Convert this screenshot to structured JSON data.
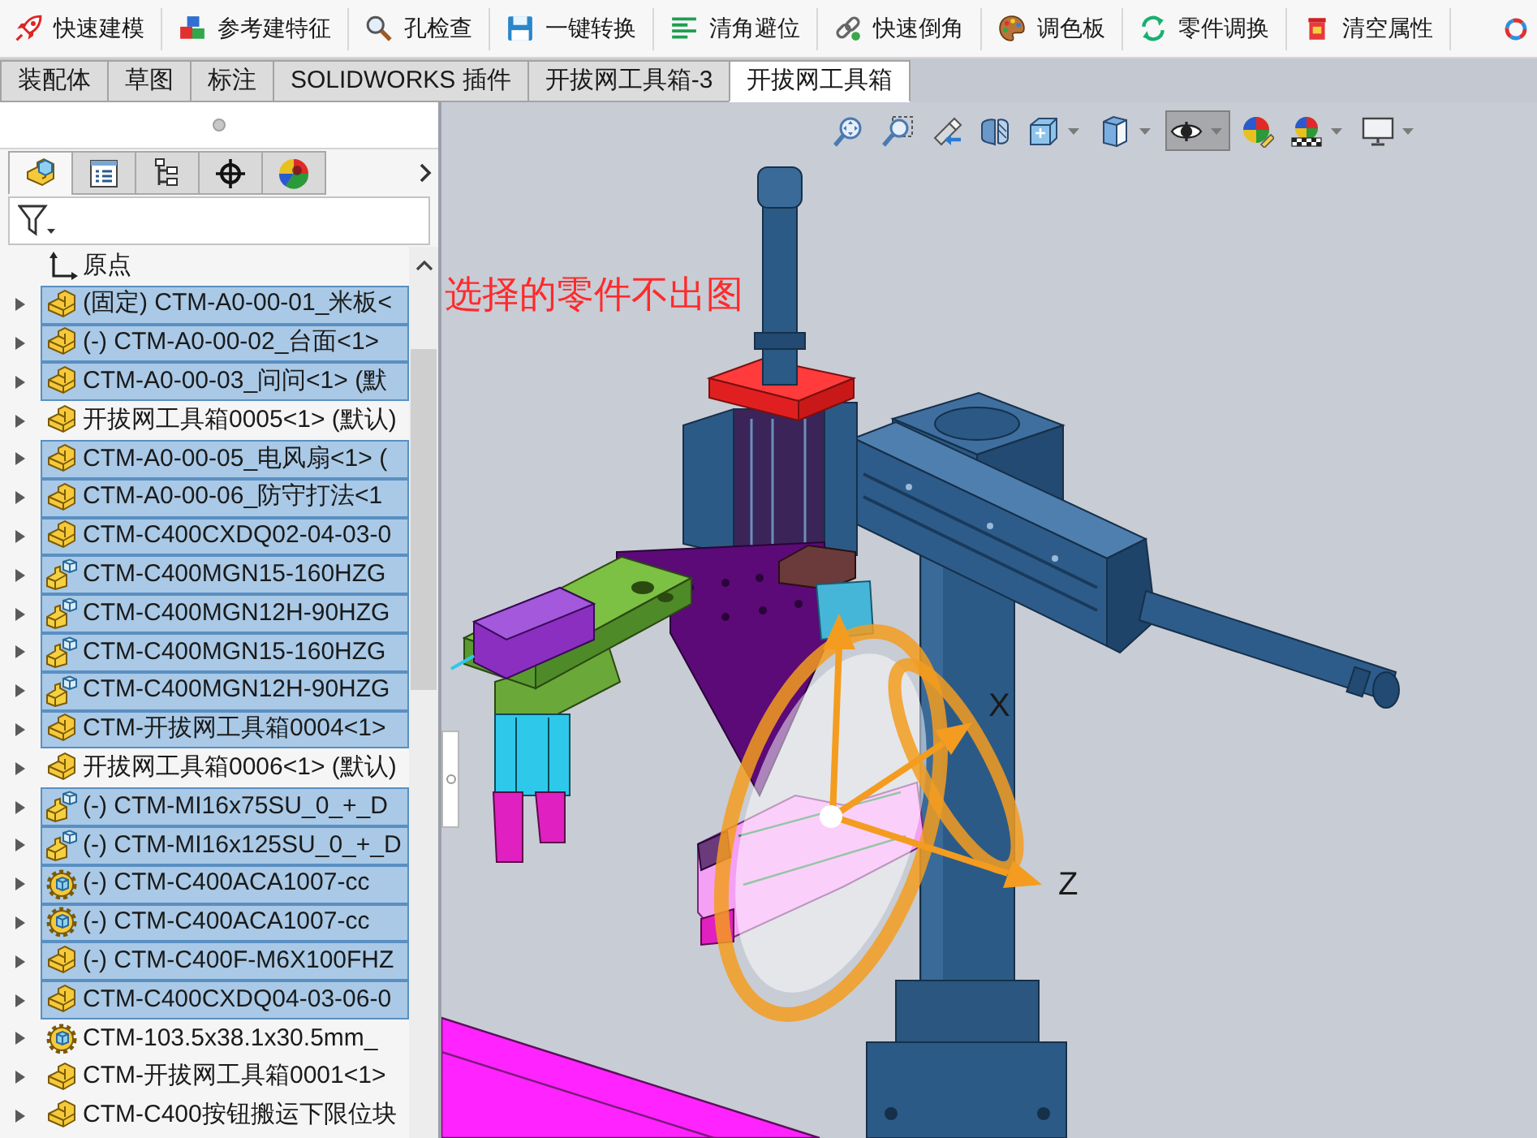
{
  "toolbar": {
    "buttons": [
      {
        "label": "快速建模"
      },
      {
        "label": "参考建特征"
      },
      {
        "label": "孔检查"
      },
      {
        "label": "一键转换"
      },
      {
        "label": "清角避位"
      },
      {
        "label": "快速倒角"
      },
      {
        "label": "调色板"
      },
      {
        "label": "零件调换"
      },
      {
        "label": "清空属性"
      }
    ]
  },
  "command_tabs": [
    {
      "label": "装配体",
      "selected": false
    },
    {
      "label": "草图",
      "selected": false
    },
    {
      "label": "标注",
      "selected": false
    },
    {
      "label": "SOLIDWORKS 插件",
      "selected": false
    },
    {
      "label": "开拔网工具箱-3",
      "selected": false
    },
    {
      "label": "开拔网工具箱",
      "selected": true
    }
  ],
  "feature_manager": {
    "panel_tabs": [
      {
        "selected": true
      },
      {
        "selected": false
      },
      {
        "selected": false
      },
      {
        "selected": false
      },
      {
        "selected": false
      }
    ],
    "tree": [
      {
        "kind": "origin",
        "label": "原点",
        "selected": false
      },
      {
        "kind": "part",
        "label": "(固定) CTM-A0-00-01_米板<",
        "selected": true,
        "expanded": false
      },
      {
        "kind": "part",
        "label": "(-) CTM-A0-00-02_台面<1>",
        "selected": true,
        "expanded": false
      },
      {
        "kind": "part",
        "label": "CTM-A0-00-03_问问<1> (默",
        "selected": true,
        "expanded": false
      },
      {
        "kind": "part",
        "label": "开拔网工具箱0005<1> (默认)",
        "selected": false,
        "expanded": false
      },
      {
        "kind": "part",
        "label": "CTM-A0-00-05_电风扇<1> (",
        "selected": true,
        "expanded": false
      },
      {
        "kind": "part",
        "label": "CTM-A0-00-06_防守打法<1",
        "selected": true,
        "expanded": false
      },
      {
        "kind": "part",
        "label": "CTM-C400CXDQ02-04-03-0",
        "selected": true,
        "expanded": false
      },
      {
        "kind": "assembly",
        "label": "CTM-C400MGN15-160HZG",
        "selected": true,
        "expanded": false
      },
      {
        "kind": "assembly",
        "label": "CTM-C400MGN12H-90HZG",
        "selected": true,
        "expanded": false
      },
      {
        "kind": "assembly",
        "label": "CTM-C400MGN15-160HZG",
        "selected": true,
        "expanded": false
      },
      {
        "kind": "assembly",
        "label": "CTM-C400MGN12H-90HZG",
        "selected": true,
        "expanded": false
      },
      {
        "kind": "part",
        "label": "CTM-开拔网工具箱0004<1>",
        "selected": true,
        "expanded": false
      },
      {
        "kind": "part",
        "label": "开拔网工具箱0006<1> (默认)",
        "selected": false,
        "expanded": false
      },
      {
        "kind": "assembly",
        "label": "(-) CTM-MI16x75SU_0_+_D",
        "selected": true,
        "expanded": false
      },
      {
        "kind": "assembly",
        "label": "(-) CTM-MI16x125SU_0_+_D",
        "selected": true,
        "expanded": false
      },
      {
        "kind": "library",
        "label": "(-) CTM-C400ACA1007-cc",
        "selected": true,
        "expanded": false
      },
      {
        "kind": "library",
        "label": "(-) CTM-C400ACA1007-cc",
        "selected": true,
        "expanded": false
      },
      {
        "kind": "part",
        "label": "(-) CTM-C400F-M6X100FHZ",
        "selected": true,
        "expanded": false
      },
      {
        "kind": "part",
        "label": "CTM-C400CXDQ04-03-06-0",
        "selected": true,
        "expanded": false
      },
      {
        "kind": "library",
        "label": "CTM-103.5x38.1x30.5mm_",
        "selected": false,
        "expanded": false
      },
      {
        "kind": "part",
        "label": "CTM-开拔网工具箱0001<1>",
        "selected": false,
        "expanded": false
      },
      {
        "kind": "part",
        "label": "CTM-C400按钮搬运下限位块",
        "selected": false,
        "expanded": false
      }
    ]
  },
  "viewport": {
    "heads_up_toolbar": [
      {
        "selected": false,
        "dropdown": false
      },
      {
        "selected": false,
        "dropdown": false
      },
      {
        "selected": false,
        "dropdown": false
      },
      {
        "selected": false,
        "dropdown": false
      },
      {
        "selected": false,
        "dropdown": true
      },
      {
        "selected": false,
        "dropdown": true
      },
      {
        "selected": true,
        "dropdown": true
      },
      {
        "selected": false,
        "dropdown": false
      },
      {
        "selected": false,
        "dropdown": true
      },
      {
        "selected": false,
        "dropdown": true
      }
    ],
    "annotation": "选择的零件不出图",
    "triad": {
      "axes": [
        {
          "label": "X"
        },
        {
          "label": "Z"
        }
      ]
    }
  }
}
